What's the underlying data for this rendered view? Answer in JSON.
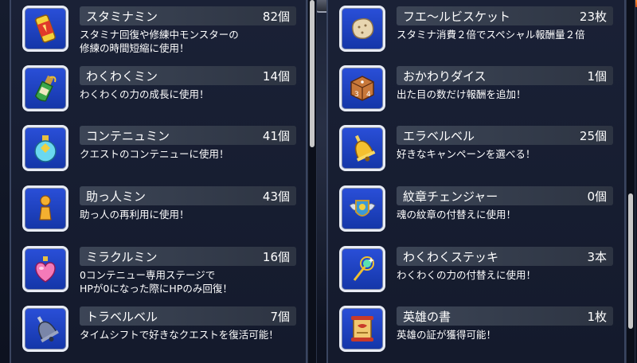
{
  "left_items": [
    {
      "name": "スタミナミン",
      "count": "82個",
      "desc": [
        "スタミナ回復や修練中モンスターの",
        "修練の時間短縮に使用！"
      ],
      "icon": "stamina-drink-icon"
    },
    {
      "name": "わくわくミン",
      "count": "14個",
      "desc": [
        "わくわくの力の成長に使用！"
      ],
      "icon": "bottle-icon"
    },
    {
      "name": "コンテニュミン",
      "count": "41個",
      "desc": [
        "クエストのコンテニューに使用！"
      ],
      "icon": "continue-potion-icon"
    },
    {
      "name": "助っ人ミン",
      "count": "43個",
      "desc": [
        "助っ人の再利用に使用！"
      ],
      "icon": "helper-figure-icon"
    },
    {
      "name": "ミラクルミン",
      "count": "16個",
      "desc": [
        "0コンテニュー専用ステージで",
        "HPが0になった際にHPのみ回復！"
      ],
      "icon": "heart-potion-icon"
    },
    {
      "name": "トラベルベル",
      "count": "7個",
      "desc": [
        "タイムシフトで好きなクエストを復活可能！"
      ],
      "icon": "travel-bell-icon"
    }
  ],
  "right_items": [
    {
      "name": "フエ～ルビスケット",
      "count": "23枚",
      "desc": [
        "スタミナ消費２倍でスペシャル報酬量２倍"
      ],
      "icon": "biscuit-icon"
    },
    {
      "name": "おかわりダイス",
      "count": "1個",
      "desc": [
        "出た目の数だけ報酬を追加！"
      ],
      "icon": "dice-icon"
    },
    {
      "name": "エラベルベル",
      "count": "25個",
      "desc": [
        "好きなキャンペーンを選べる！"
      ],
      "icon": "golden-bell-icon"
    },
    {
      "name": "紋章チェンジャー",
      "count": "0個",
      "desc": [
        "魂の紋章の付替えに使用！"
      ],
      "icon": "emblem-icon"
    },
    {
      "name": "わくわくステッキ",
      "count": "3本",
      "desc": [
        "わくわくの力の付替えに使用！"
      ],
      "icon": "wand-icon"
    },
    {
      "name": "英雄の書",
      "count": "1枚",
      "desc": [
        "英雄の証が獲得可能！"
      ],
      "icon": "scroll-icon"
    }
  ],
  "colors": {
    "icon_bg": "#1e44c8",
    "namebar": "#363e4e",
    "panel": "#171d30"
  }
}
